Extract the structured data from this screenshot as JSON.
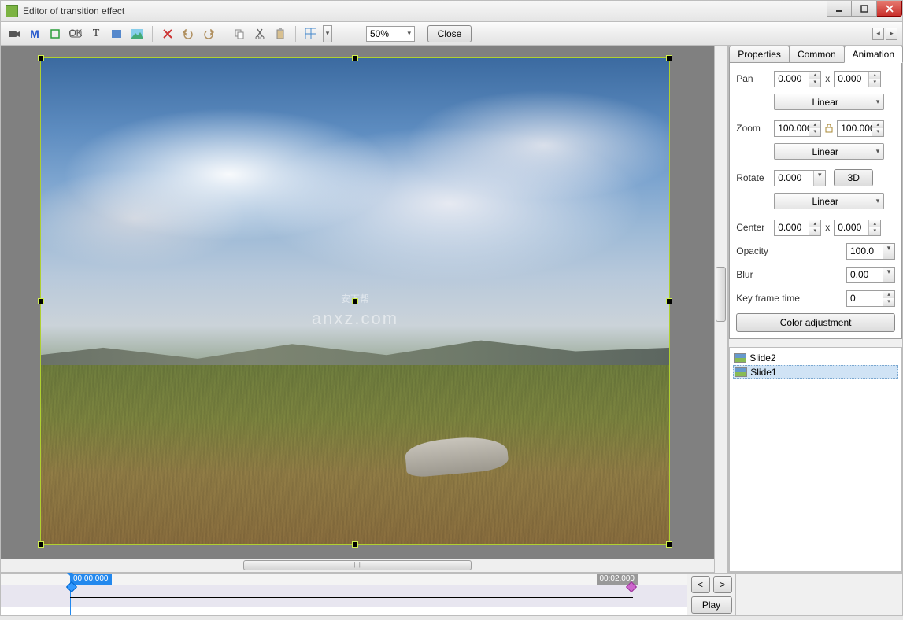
{
  "window": {
    "title": "Editor of transition effect"
  },
  "toolbar": {
    "zoom": "50%",
    "close": "Close"
  },
  "canvas": {
    "watermark_big": "安下帮",
    "watermark_small": "anxz.com"
  },
  "tabs": {
    "properties": "Properties",
    "common": "Common",
    "animation": "Animation"
  },
  "props": {
    "pan_label": "Pan",
    "pan_x": "0.000",
    "pan_y": "0.000",
    "pan_curve": "Linear",
    "zoom_label": "Zoom",
    "zoom_x": "100.000",
    "zoom_y": "100.000",
    "zoom_curve": "Linear",
    "rotate_label": "Rotate",
    "rotate_val": "0.000",
    "rotate_3d": "3D",
    "rotate_curve": "Linear",
    "center_label": "Center",
    "center_x": "0.000",
    "center_y": "0.000",
    "opacity_label": "Opacity",
    "opacity_val": "100.0",
    "blur_label": "Blur",
    "blur_val": "0.00",
    "kft_label": "Key frame time",
    "kft_val": "0",
    "color_btn": "Color adjustment",
    "x_sep": "x"
  },
  "slides": {
    "items": [
      {
        "label": "Slide2"
      },
      {
        "label": "Slide1"
      }
    ]
  },
  "timeline": {
    "t_start": "00:00.000",
    "t_end": "00:02.000",
    "prev": "<",
    "next": ">",
    "play": "Play"
  }
}
